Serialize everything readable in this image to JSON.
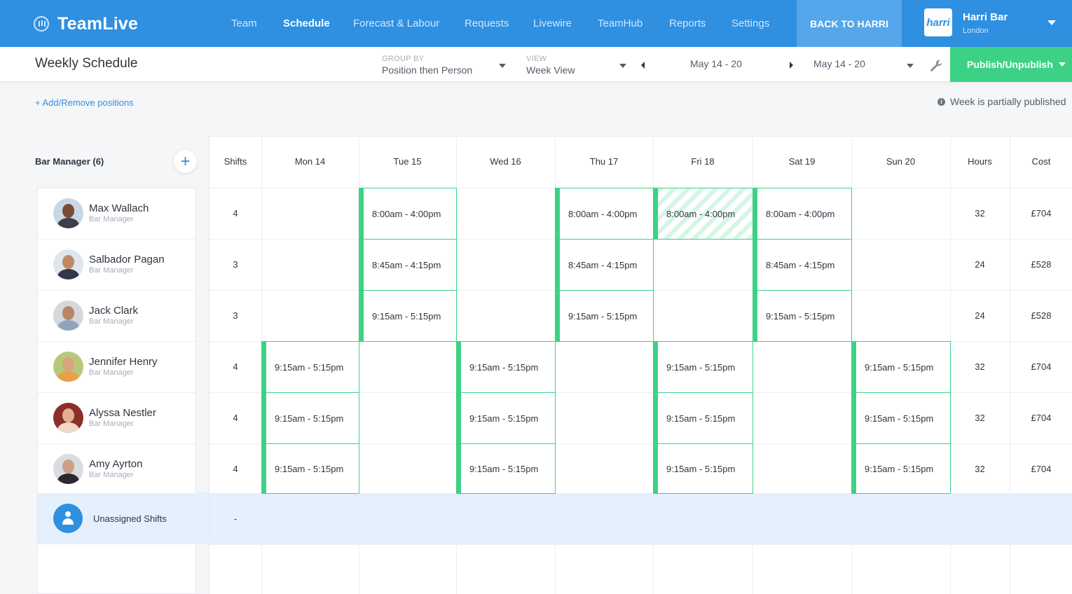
{
  "nav": {
    "brand": "TeamLive",
    "items": [
      "Team",
      "Schedule",
      "Forecast & Labour",
      "Requests",
      "Livewire",
      "TeamHub",
      "Reports",
      "Settings"
    ],
    "active": "Schedule",
    "back_label": "BACK TO HARRI",
    "org_logo": "harri",
    "org_name": "Harri Bar",
    "org_location": "London"
  },
  "toolbar": {
    "title": "Weekly Schedule",
    "group_by_label": "GROUP BY",
    "group_by_value": "Position then Person",
    "view_label": "VIEW",
    "view_value": "Week View",
    "date_range": "May 14 - 20",
    "date_select": "May 14 - 20",
    "publish_label": "Publish/Unpublish"
  },
  "subbar": {
    "add_positions": "+ Add/Remove positions",
    "status": "Week is partially published"
  },
  "group": {
    "label": "Bar Manager (6)",
    "add_icon": "+"
  },
  "columns": [
    "Shifts",
    "Mon 14",
    "Tue 15",
    "Wed 16",
    "Thu 17",
    "Fri 18",
    "Sat 19",
    "Sun 20",
    "Hours",
    "Cost"
  ],
  "people": [
    {
      "name": "Max Wallach",
      "role": "Bar Manager",
      "shifts": "4",
      "hours": "32",
      "cost": "£704"
    },
    {
      "name": "Salbador Pagan",
      "role": "Bar Manager",
      "shifts": "3",
      "hours": "24",
      "cost": "£528"
    },
    {
      "name": "Jack Clark",
      "role": "Bar Manager",
      "shifts": "3",
      "hours": "24",
      "cost": "£528"
    },
    {
      "name": "Jennifer Henry",
      "role": "Bar Manager",
      "shifts": "4",
      "hours": "32",
      "cost": "£704"
    },
    {
      "name": "Alyssa Nestler",
      "role": "Bar Manager",
      "shifts": "4",
      "hours": "32",
      "cost": "£704"
    },
    {
      "name": "Amy Ayrton",
      "role": "Bar Manager",
      "shifts": "4",
      "hours": "32",
      "cost": "£704"
    }
  ],
  "unassigned": {
    "label": "Unassigned Shifts",
    "shifts": "-"
  },
  "shifts": [
    {
      "row": 0,
      "day": 1,
      "time": "8:00am - 4:00pm",
      "published": true
    },
    {
      "row": 0,
      "day": 3,
      "time": "8:00am - 4:00pm",
      "published": true
    },
    {
      "row": 0,
      "day": 4,
      "time": "8:00am - 4:00pm",
      "published": false
    },
    {
      "row": 0,
      "day": 5,
      "time": "8:00am - 4:00pm",
      "published": true
    },
    {
      "row": 1,
      "day": 1,
      "time": "8:45am - 4:15pm",
      "published": true
    },
    {
      "row": 1,
      "day": 3,
      "time": "8:45am - 4:15pm",
      "published": true
    },
    {
      "row": 1,
      "day": 5,
      "time": "8:45am - 4:15pm",
      "published": true
    },
    {
      "row": 2,
      "day": 1,
      "time": "9:15am - 5:15pm",
      "published": true
    },
    {
      "row": 2,
      "day": 3,
      "time": "9:15am - 5:15pm",
      "published": true
    },
    {
      "row": 2,
      "day": 5,
      "time": "9:15am - 5:15pm",
      "published": true
    },
    {
      "row": 3,
      "day": 0,
      "time": "9:15am - 5:15pm",
      "published": true
    },
    {
      "row": 3,
      "day": 2,
      "time": "9:15am - 5:15pm",
      "published": true
    },
    {
      "row": 3,
      "day": 4,
      "time": "9:15am - 5:15pm",
      "published": true
    },
    {
      "row": 3,
      "day": 6,
      "time": "9:15am - 5:15pm",
      "published": true
    },
    {
      "row": 4,
      "day": 0,
      "time": "9:15am - 5:15pm",
      "published": true
    },
    {
      "row": 4,
      "day": 2,
      "time": "9:15am - 5:15pm",
      "published": true
    },
    {
      "row": 4,
      "day": 4,
      "time": "9:15am - 5:15pm",
      "published": true
    },
    {
      "row": 4,
      "day": 6,
      "time": "9:15am - 5:15pm",
      "published": true
    },
    {
      "row": 5,
      "day": 0,
      "time": "9:15am - 5:15pm",
      "published": true
    },
    {
      "row": 5,
      "day": 2,
      "time": "9:15am - 5:15pm",
      "published": true
    },
    {
      "row": 5,
      "day": 4,
      "time": "9:15am - 5:15pm",
      "published": true
    },
    {
      "row": 5,
      "day": 6,
      "time": "9:15am - 5:15pm",
      "published": true
    }
  ],
  "colors": {
    "primary": "#2f8fe0",
    "accent_green": "#3dd186",
    "unassigned_bg": "#e4f0fb"
  },
  "icons": [
    "teamlive-logo-icon",
    "chevron-down-icon",
    "chevron-left-icon",
    "chevron-right-icon",
    "wrench-icon",
    "info-icon",
    "plus-icon",
    "user-icon"
  ]
}
